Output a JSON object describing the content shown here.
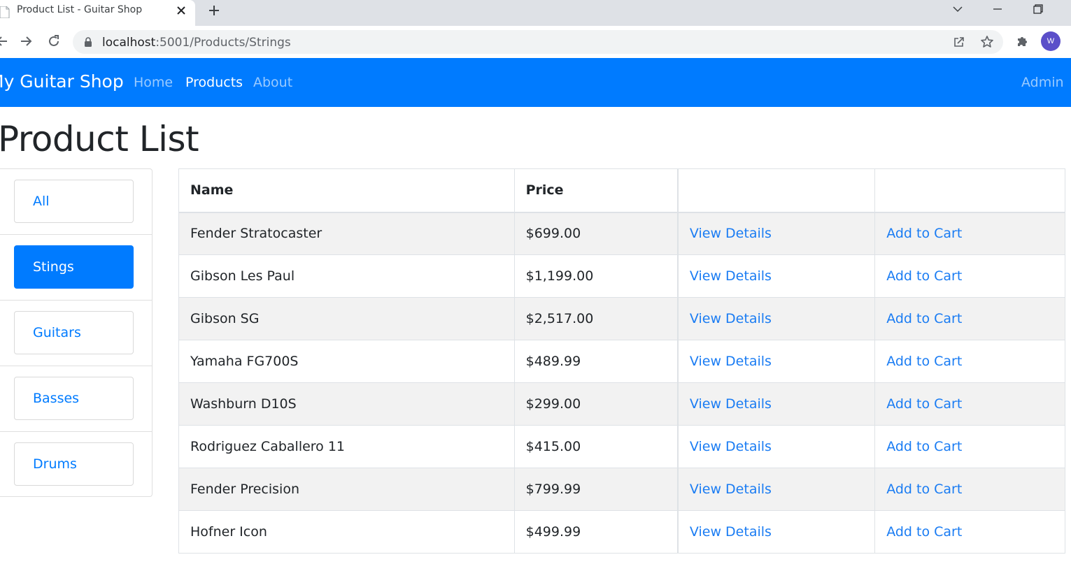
{
  "browser": {
    "tab_title": "Product List - Guitar Shop",
    "url_host": "localhost",
    "url_path": ":5001/Products/Strings",
    "profile_initial": "W",
    "icons": [
      "page-icon",
      "close-icon",
      "plus-icon",
      "chevron-down-icon",
      "minimize-icon",
      "restore-icon",
      "back-icon",
      "forward-icon",
      "reload-icon",
      "lock-icon",
      "share-icon",
      "star-icon",
      "puzzle-icon"
    ]
  },
  "navbar": {
    "brand": "My Guitar Shop",
    "links": [
      {
        "label": "Home"
      },
      {
        "label": "Products"
      },
      {
        "label": "About"
      }
    ],
    "admin": "Admin"
  },
  "page": {
    "title": "Product List"
  },
  "categories": [
    {
      "label": "All"
    },
    {
      "label": "Stings"
    },
    {
      "label": "Guitars"
    },
    {
      "label": "Basses"
    },
    {
      "label": "Drums"
    }
  ],
  "table": {
    "headers": [
      "Name",
      "Price",
      "",
      ""
    ],
    "rows": [
      {
        "name": "Fender Stratocaster",
        "price": "$699.00",
        "details": "View Details",
        "cart": "Add to Cart"
      },
      {
        "name": "Gibson Les Paul",
        "price": "$1,199.00",
        "details": "View Details",
        "cart": "Add to Cart"
      },
      {
        "name": "Gibson SG",
        "price": "$2,517.00",
        "details": "View Details",
        "cart": "Add to Cart"
      },
      {
        "name": "Yamaha FG700S",
        "price": "$489.99",
        "details": "View Details",
        "cart": "Add to Cart"
      },
      {
        "name": "Washburn D10S",
        "price": "$299.00",
        "details": "View Details",
        "cart": "Add to Cart"
      },
      {
        "name": "Rodriguez Caballero 11",
        "price": "$415.00",
        "details": "View Details",
        "cart": "Add to Cart"
      },
      {
        "name": "Fender Precision",
        "price": "$799.99",
        "details": "View Details",
        "cart": "Add to Cart"
      },
      {
        "name": "Hofner Icon",
        "price": "$499.99",
        "details": "View Details",
        "cart": "Add to Cart"
      }
    ]
  },
  "colors": {
    "primary": "#007bff",
    "link": "#1a7cf3",
    "stripe": "#f2f2f2",
    "tabstrip": "#dee1e6",
    "profile": "#5b4fc9"
  }
}
